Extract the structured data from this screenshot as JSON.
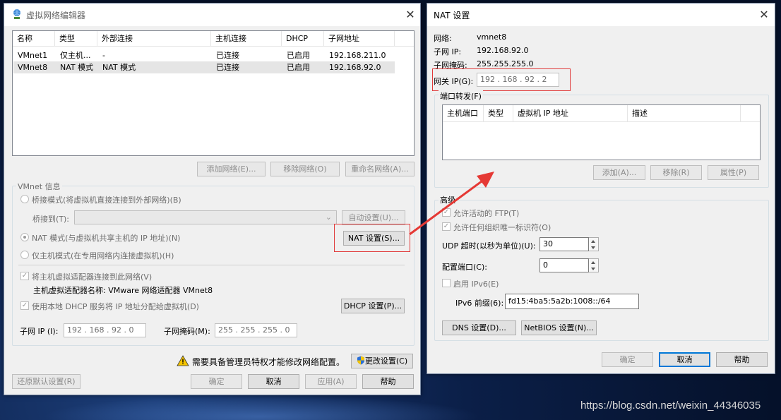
{
  "watermark": "https://blog.csdn.net/weixin_44346035",
  "colors": {
    "accent_arrow": "#e53935",
    "highlight_box": "#e03a3a"
  },
  "vne": {
    "title": "虚拟网络编辑器",
    "icon": "network-globe-icon",
    "columns": [
      "名称",
      "类型",
      "外部连接",
      "主机连接",
      "DHCP",
      "子网地址"
    ],
    "rows": [
      [
        "VMnet1",
        "仅主机...",
        "-",
        "已连接",
        "已启用",
        "192.168.211.0"
      ],
      [
        "VMnet8",
        "NAT 模式",
        "NAT 模式",
        "已连接",
        "已启用",
        "192.168.92.0"
      ]
    ],
    "add_network": "添加网络(E)...",
    "remove_network": "移除网络(O)",
    "rename_network": "重命名网络(A)...",
    "vmnet_info": "VMnet 信息",
    "bridge_mode": "桥接模式(将虚拟机直接连接到外部网络)(B)",
    "bridge_to": "桥接到(T):",
    "auto_settings": "自动设置(U)...",
    "nat_mode": "NAT 模式(与虚拟机共享主机的 IP 地址)(N)",
    "nat_settings": "NAT 设置(S)...",
    "host_only": "仅主机模式(在专用网络内连接虚拟机)(H)",
    "connect_adapter": "将主机虚拟适配器连接到此网络(V)",
    "adapter_name": "主机虚拟适配器名称: VMware 网络适配器 VMnet8",
    "use_dhcp": "使用本地 DHCP 服务将 IP 地址分配给虚拟机(D)",
    "dhcp_settings": "DHCP 设置(P)...",
    "subnet_ip_label": "子网 IP (I):",
    "subnet_ip": "192 . 168 . 92 . 0",
    "subnet_mask_label": "子网掩码(M):",
    "subnet_mask": "255 . 255 . 255 . 0",
    "admin_warning": "需要具备管理员特权才能修改网络配置。",
    "change_settings": "更改设置(C)",
    "restore_defaults": "还原默认设置(R)",
    "ok": "确定",
    "cancel": "取消",
    "apply": "应用(A)",
    "help": "帮助"
  },
  "nat": {
    "title": "NAT 设置",
    "network_label": "网络:",
    "network": "vmnet8",
    "subnet_ip_label": "子网 IP:",
    "subnet_ip": "192.168.92.0",
    "subnet_mask_label": "子网掩码:",
    "subnet_mask": "255.255.255.0",
    "gateway_label": "网关 IP(G):",
    "gateway": "192 . 168 . 92 . 2",
    "port_forwarding": "端口转发(F)",
    "pf_columns": [
      "主机端口",
      "类型",
      "虚拟机 IP 地址",
      "描述"
    ],
    "add": "添加(A)...",
    "remove": "移除(R)",
    "properties": "属性(P)",
    "advanced": "高级",
    "allow_ftp": "允许活动的 FTP(T)",
    "allow_oui": "允许任何组织唯一标识符(O)",
    "udp_timeout_label": "UDP 超时(以秒为单位)(U):",
    "udp_timeout": "30",
    "config_port_label": "配置端口(C):",
    "config_port": "0",
    "enable_ipv6": "启用 IPv6(E)",
    "ipv6_prefix_label": "IPv6 前缀(6):",
    "ipv6_prefix": "fd15:4ba5:5a2b:1008::/64",
    "dns_settings": "DNS 设置(D)...",
    "netbios_settings": "NetBIOS 设置(N)...",
    "ok": "确定",
    "cancel": "取消",
    "help": "帮助"
  }
}
